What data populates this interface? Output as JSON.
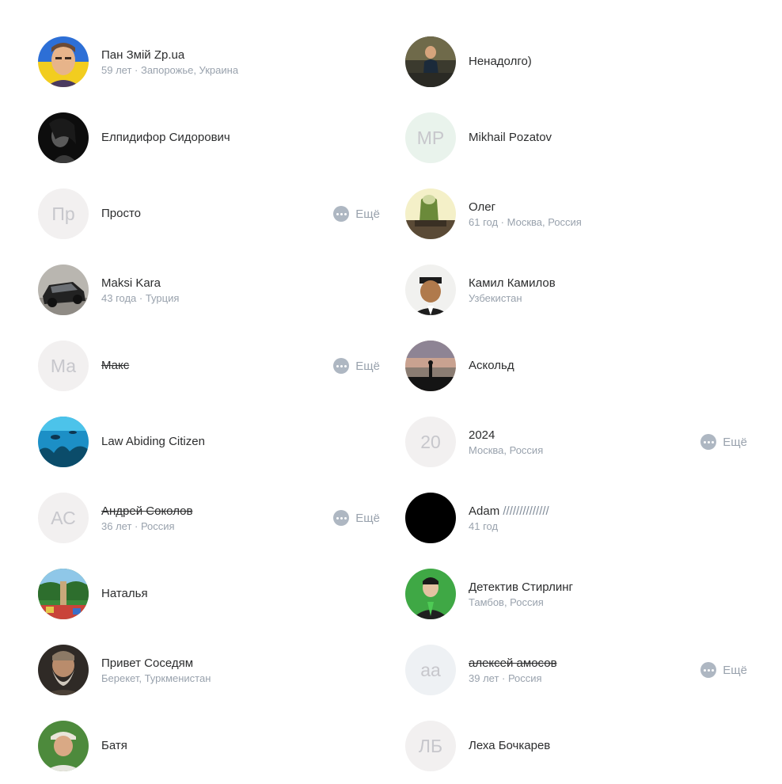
{
  "more_label": "Ещё",
  "left": [
    {
      "name": "Пан Змій Zp.ua",
      "sub": "59 лет · Запорожье, Украина",
      "avatar": "photo-man-flag-icon",
      "initials": "",
      "struck": false,
      "more": false
    },
    {
      "name": "Елпидифор Сидорович",
      "sub": "",
      "avatar": "photo-bw-portrait-icon",
      "initials": "",
      "struck": false,
      "more": false
    },
    {
      "name": "Просто",
      "sub": "",
      "avatar": "initials",
      "initials": "Пр",
      "struck": false,
      "more": true
    },
    {
      "name": "Maksi Kara",
      "sub": "43 года · Турция",
      "avatar": "photo-car-icon",
      "initials": "",
      "struck": false,
      "more": false
    },
    {
      "name": "Макс",
      "sub": "",
      "avatar": "initials",
      "initials": "Ма",
      "struck": true,
      "more": true
    },
    {
      "name": "Law Abiding Citizen",
      "sub": "",
      "avatar": "photo-underwater-icon",
      "initials": "",
      "struck": false,
      "more": false
    },
    {
      "name": "Андрей Соколов",
      "sub": "36 лет · Россия",
      "avatar": "initials",
      "initials": "АС",
      "struck": true,
      "more": true
    },
    {
      "name": "Наталья",
      "sub": "",
      "avatar": "photo-jungle-icon",
      "initials": "",
      "struck": false,
      "more": false
    },
    {
      "name": "Привет Соседям",
      "sub": "Берекет, Туркменистан",
      "avatar": "photo-bearded-man-icon",
      "initials": "",
      "struck": false,
      "more": false
    },
    {
      "name": "Батя",
      "sub": "",
      "avatar": "photo-man-outdoors-icon",
      "initials": "",
      "struck": false,
      "more": false
    }
  ],
  "right": [
    {
      "name": "Ненадолго)",
      "sub": "",
      "avatar": "photo-woman-sitting-icon",
      "initials": "",
      "struck": false,
      "more": false
    },
    {
      "name": "Mikhail Pozatov",
      "sub": "",
      "avatar": "initials",
      "initials": "MP",
      "struck": false,
      "more": false
    },
    {
      "name": "Олег",
      "sub": "61 год · Москва, Россия",
      "avatar": "photo-statue-icon",
      "initials": "",
      "struck": false,
      "more": false
    },
    {
      "name": "Камил Камилов",
      "sub": "Узбекистан",
      "avatar": "photo-man-hat-icon",
      "initials": "",
      "struck": false,
      "more": false
    },
    {
      "name": "Аскольд",
      "sub": "",
      "avatar": "photo-sunset-beach-icon",
      "initials": "",
      "struck": false,
      "more": false
    },
    {
      "name": "2024",
      "sub": "Москва, Россия",
      "avatar": "initials",
      "initials": "20",
      "struck": false,
      "more": true
    },
    {
      "name": "Adam",
      "name_tail": " //////////////",
      "sub": "41 год",
      "avatar": "photo-black-icon",
      "initials": "",
      "struck": false,
      "more": false
    },
    {
      "name": "Детектив Стирлинг",
      "sub": "Тамбов, Россия",
      "avatar": "photo-man-green-suit-icon",
      "initials": "",
      "struck": false,
      "more": false
    },
    {
      "name": "алексей амосов",
      "sub": "39 лет · Россия",
      "avatar": "initials",
      "initials": "аа",
      "struck": true,
      "more": true
    },
    {
      "name": "Леха Бочкарев",
      "sub": "",
      "avatar": "initials",
      "initials": "ЛБ",
      "struck": false,
      "more": false
    }
  ]
}
